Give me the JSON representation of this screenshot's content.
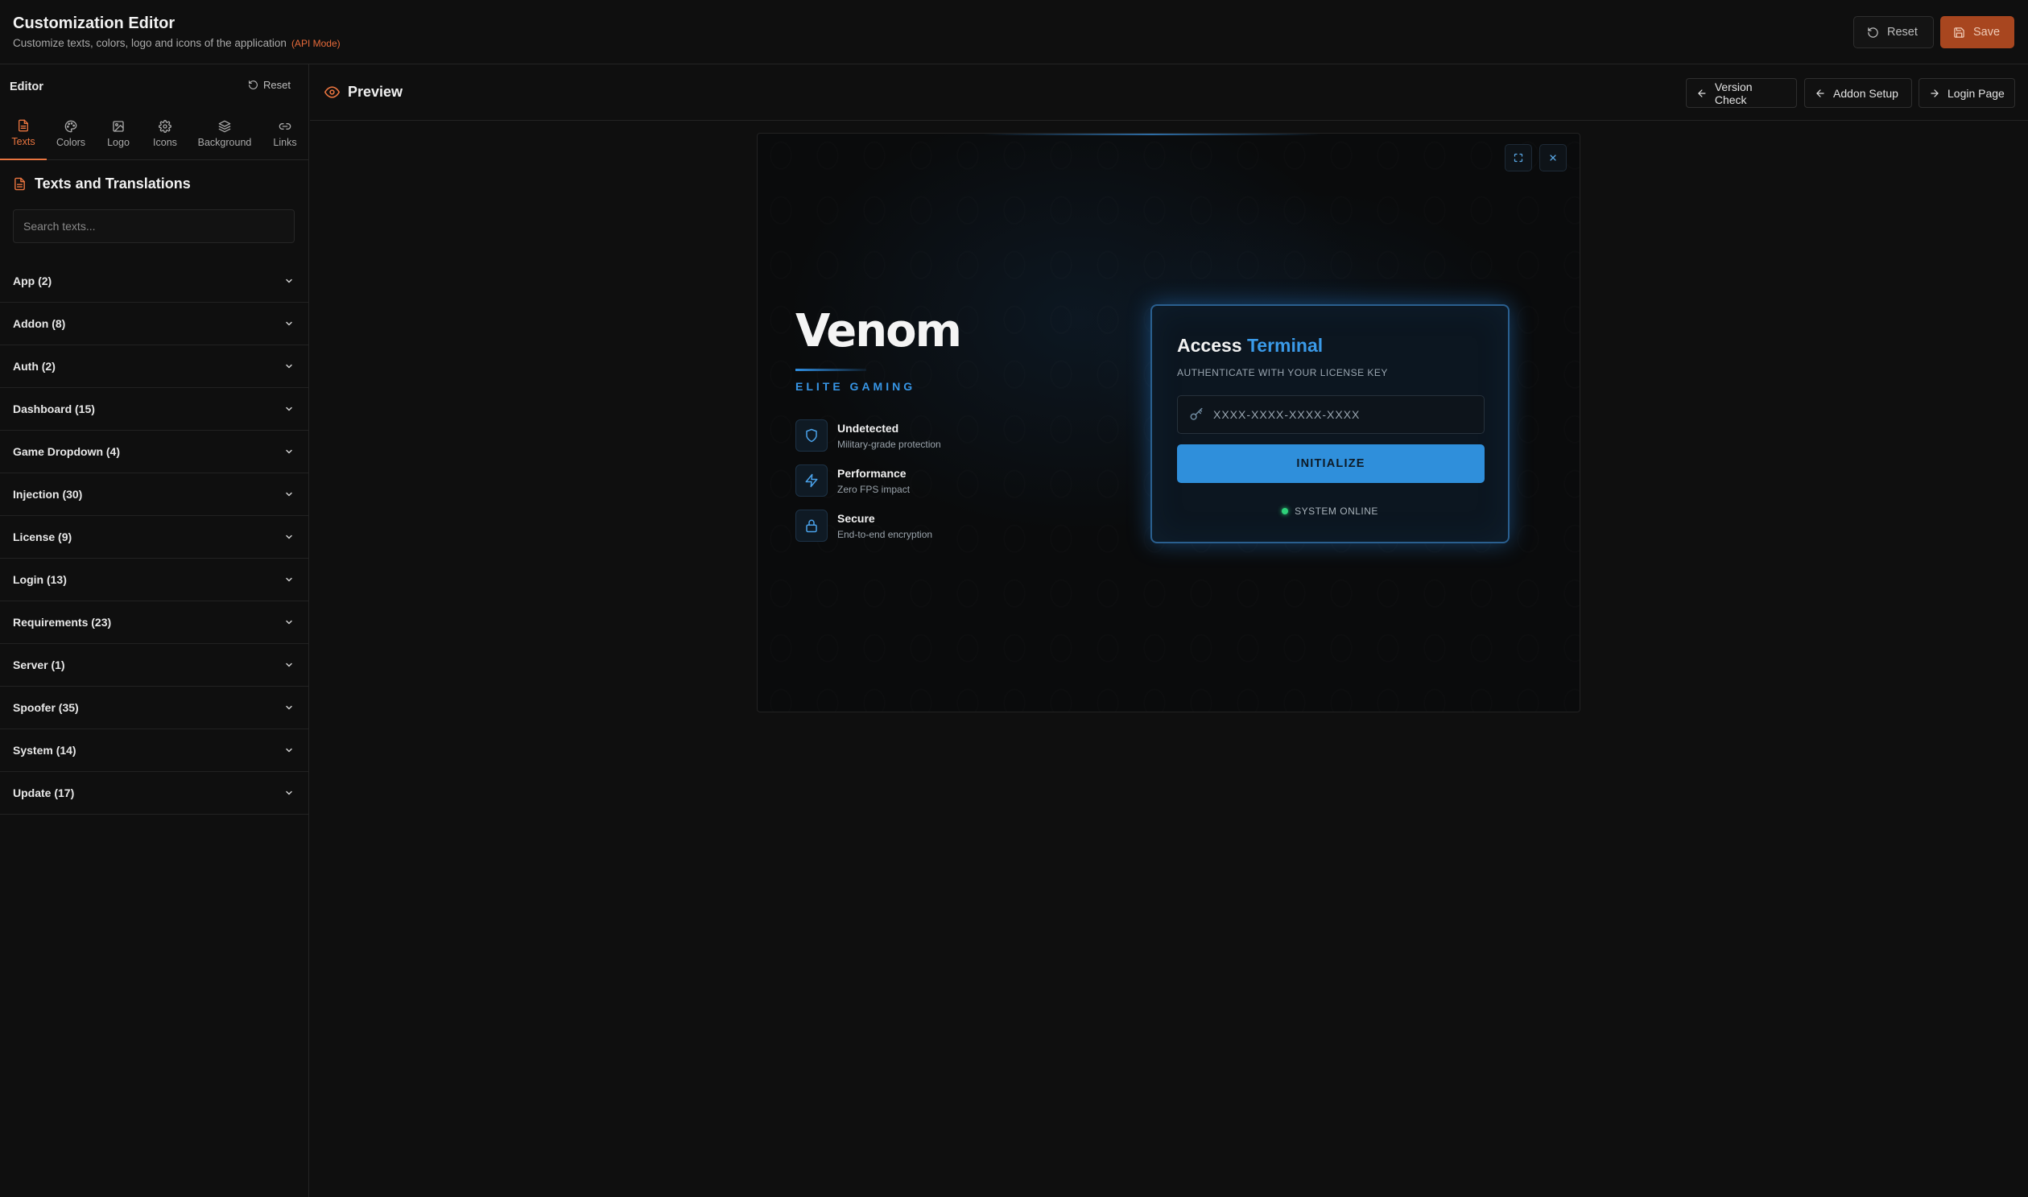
{
  "header": {
    "title": "Customization Editor",
    "subtitle": "Customize texts, colors, logo and icons of the application",
    "mode_badge": "(API Mode)",
    "reset_label": "Reset",
    "save_label": "Save"
  },
  "sidebar": {
    "title": "Editor",
    "reset_label": "Reset",
    "tabs": [
      {
        "label": "Texts",
        "icon": "document-icon",
        "active": true
      },
      {
        "label": "Colors",
        "icon": "palette-icon"
      },
      {
        "label": "Logo",
        "icon": "image-icon"
      },
      {
        "label": "Icons",
        "icon": "gear-icon"
      },
      {
        "label": "Background",
        "icon": "layers-icon"
      },
      {
        "label": "Links",
        "icon": "link-icon"
      }
    ],
    "section_title": "Texts and Translations",
    "search_placeholder": "Search texts...",
    "categories": [
      {
        "label": "App (2)"
      },
      {
        "label": "Addon (8)"
      },
      {
        "label": "Auth (2)"
      },
      {
        "label": "Dashboard (15)"
      },
      {
        "label": "Game Dropdown (4)"
      },
      {
        "label": "Injection (30)"
      },
      {
        "label": "License (9)"
      },
      {
        "label": "Login (13)"
      },
      {
        "label": "Requirements (23)"
      },
      {
        "label": "Server (1)"
      },
      {
        "label": "Spoofer (35)"
      },
      {
        "label": "System (14)"
      },
      {
        "label": "Update (17)"
      }
    ]
  },
  "preview": {
    "title": "Preview",
    "nav": {
      "version_check": "Version Check",
      "addon_setup": "Addon Setup",
      "login_page": "Login Page"
    },
    "app": {
      "brand": "Venom",
      "brand_sub": "ELITE GAMING",
      "features": [
        {
          "title": "Undetected",
          "desc": "Military-grade protection",
          "icon": "shield-icon"
        },
        {
          "title": "Performance",
          "desc": "Zero FPS impact",
          "icon": "bolt-icon"
        },
        {
          "title": "Secure",
          "desc": "End-to-end encryption",
          "icon": "lock-icon"
        }
      ],
      "card": {
        "title_main": "Access",
        "title_accent": "Terminal",
        "subtitle": "AUTHENTICATE WITH YOUR LICENSE KEY",
        "key_placeholder": "XXXX-XXXX-XXXX-XXXX",
        "button": "INITIALIZE",
        "status": "SYSTEM ONLINE"
      }
    }
  },
  "colors": {
    "accent": "#e8743f",
    "save_bg": "#a8461f",
    "preview_accent": "#2f8fdb",
    "status_online": "#2ed17a"
  }
}
